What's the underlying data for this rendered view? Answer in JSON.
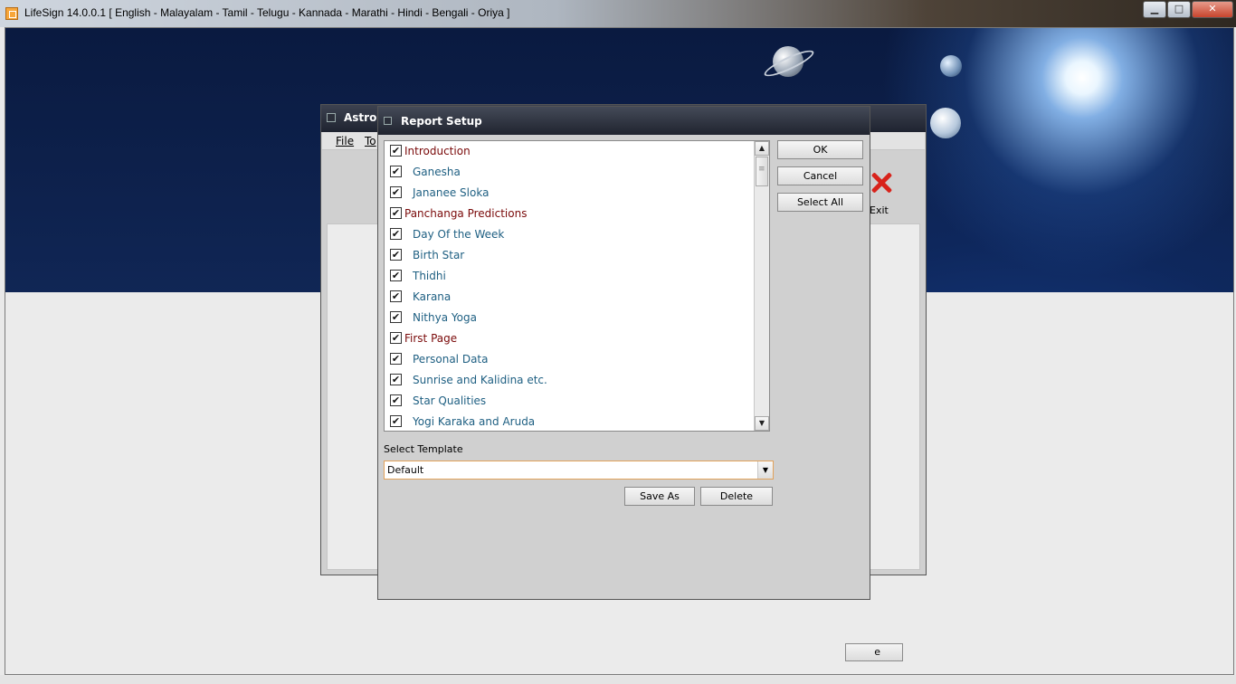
{
  "window": {
    "title": "LifeSign 14.0.0.1 [ English - Malayalam - Tamil - Telugu - Kannada - Marathi - Hindi - Bengali - Oriya ]",
    "min_glyph": "▁",
    "max_glyph": "□",
    "close_glyph": "✕"
  },
  "astro_window": {
    "title": "Astro-",
    "menu": [
      "File",
      "To"
    ],
    "exit_label": "Exit",
    "partial_button": "e"
  },
  "dialog": {
    "title": "Report Setup",
    "buttons": {
      "ok": "OK",
      "cancel": "Cancel",
      "select_all": "Select All",
      "save_as": "Save As",
      "delete": "Delete"
    },
    "template_label": "Select Template",
    "template_value": "Default",
    "items": [
      {
        "label": "Introduction",
        "type": "section",
        "checked": true
      },
      {
        "label": "Ganesha",
        "type": "sub",
        "checked": true
      },
      {
        "label": "Jananee Sloka",
        "type": "sub",
        "checked": true
      },
      {
        "label": "Panchanga Predictions",
        "type": "section",
        "checked": true
      },
      {
        "label": "Day Of the Week",
        "type": "sub",
        "checked": true
      },
      {
        "label": "Birth Star",
        "type": "sub",
        "checked": true
      },
      {
        "label": "Thidhi",
        "type": "sub",
        "checked": true
      },
      {
        "label": "Karana",
        "type": "sub",
        "checked": true
      },
      {
        "label": "Nithya Yoga",
        "type": "sub",
        "checked": true
      },
      {
        "label": "First Page",
        "type": "section",
        "checked": true
      },
      {
        "label": "Personal Data",
        "type": "sub",
        "checked": true
      },
      {
        "label": "Sunrise and Kalidina etc.",
        "type": "sub",
        "checked": true
      },
      {
        "label": "Star Qualities",
        "type": "sub",
        "checked": true
      },
      {
        "label": "Yogi Karaka and Aruda",
        "type": "sub",
        "checked": true
      }
    ],
    "check_glyph": "✔",
    "scroll_up_glyph": "▲",
    "scroll_down_glyph": "▼",
    "dropdown_glyph": "▼"
  },
  "colors": {
    "section_text": "#7a0a0a",
    "sub_text": "#1e5f82",
    "dialog_titlebar": "#20242f",
    "combo_border": "#e2a25a"
  }
}
